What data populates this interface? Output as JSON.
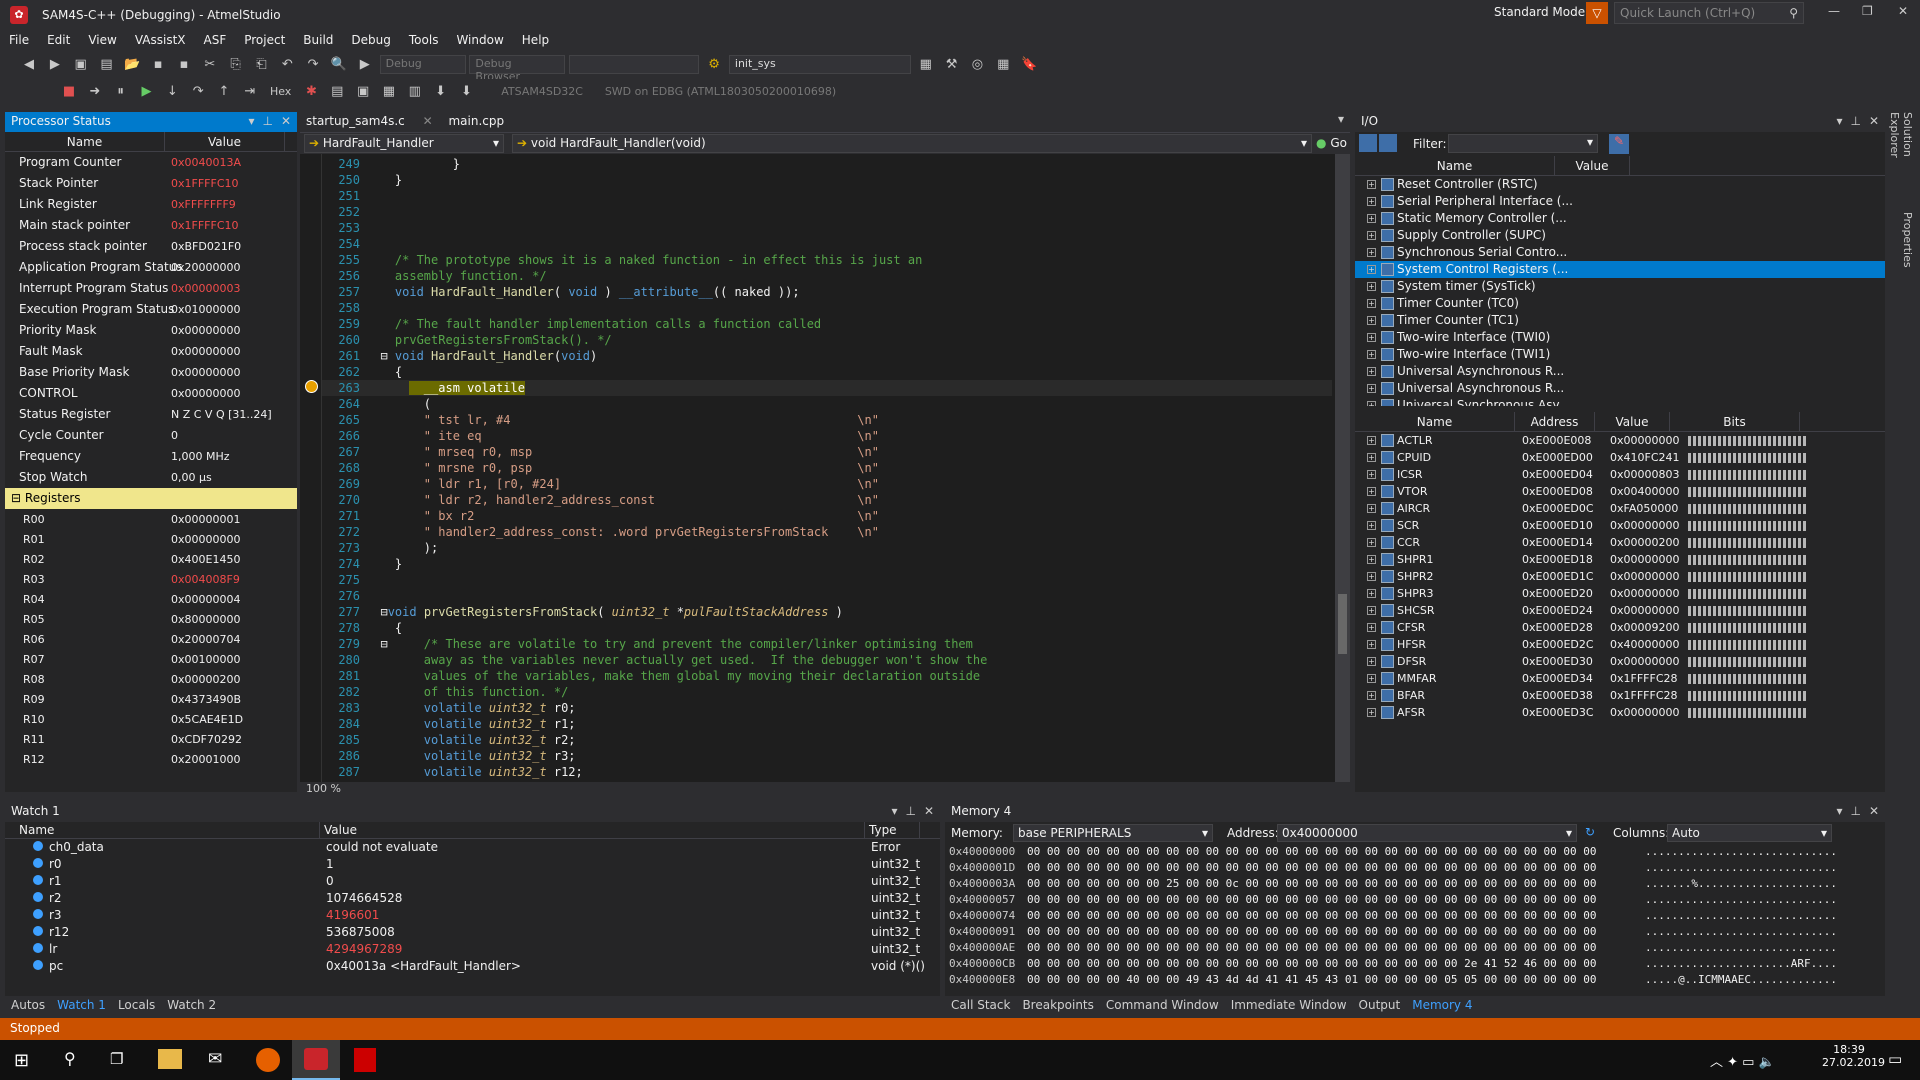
{
  "window": {
    "title": "SAM4S-C++ (Debugging) - AtmelStudio",
    "mode": "Standard Mode",
    "quick_launch": "Quick Launch (Ctrl+Q)"
  },
  "menu": [
    "File",
    "Edit",
    "View",
    "VAssistX",
    "ASF",
    "Project",
    "Build",
    "Debug",
    "Tools",
    "Window",
    "Help"
  ],
  "toolbar": {
    "config": "Debug",
    "platform": "Debug Browser",
    "func": "init_sys",
    "hex": "Hex",
    "device": "ATSAM4SD32C",
    "tool": "SWD on EDBG (ATML1803050200010698)"
  },
  "processor": {
    "title": "Processor Status",
    "col_name": "Name",
    "col_value": "Value",
    "rows": [
      {
        "n": "Program Counter",
        "v": "0x0040013A",
        "red": true
      },
      {
        "n": "Stack Pointer",
        "v": "0x1FFFFC10",
        "red": true
      },
      {
        "n": "Link Register",
        "v": "0xFFFFFFF9",
        "red": true
      },
      {
        "n": "Main stack pointer",
        "v": "0x1FFFFC10",
        "red": true
      },
      {
        "n": "Process stack pointer",
        "v": "0xBFD021F0",
        "red": false
      },
      {
        "n": "Application Program Status",
        "v": "0x20000000",
        "red": false
      },
      {
        "n": "Interrupt Program Status",
        "v": "0x00000003",
        "red": true
      },
      {
        "n": "Execution Program Status",
        "v": "0x01000000",
        "red": false
      },
      {
        "n": "Priority Mask",
        "v": "0x00000000",
        "red": false
      },
      {
        "n": "Fault Mask",
        "v": "0x00000000",
        "red": false
      },
      {
        "n": "Base Priority Mask",
        "v": "0x00000000",
        "red": false
      },
      {
        "n": "CONTROL",
        "v": "0x00000000",
        "red": false
      },
      {
        "n": "Status Register",
        "v": "N Z C V Q [31..24]",
        "red": false
      },
      {
        "n": "Cycle Counter",
        "v": "0",
        "red": false
      },
      {
        "n": "Frequency",
        "v": "1,000 MHz",
        "red": false
      },
      {
        "n": "Stop Watch",
        "v": "0,00 µs",
        "red": false
      }
    ],
    "registers_label": "Registers",
    "regs": [
      {
        "n": "R00",
        "v": "0x00000001",
        "red": false
      },
      {
        "n": "R01",
        "v": "0x00000000",
        "red": false
      },
      {
        "n": "R02",
        "v": "0x400E1450",
        "red": false
      },
      {
        "n": "R03",
        "v": "0x004008F9",
        "red": true
      },
      {
        "n": "R04",
        "v": "0x00000004",
        "red": false
      },
      {
        "n": "R05",
        "v": "0x80000000",
        "red": false
      },
      {
        "n": "R06",
        "v": "0x20000704",
        "red": false
      },
      {
        "n": "R07",
        "v": "0x00100000",
        "red": false
      },
      {
        "n": "R08",
        "v": "0x00000200",
        "red": false
      },
      {
        "n": "R09",
        "v": "0x4373490B",
        "red": false
      },
      {
        "n": "R10",
        "v": "0x5CAE4E1D",
        "red": false
      },
      {
        "n": "R11",
        "v": "0xCDF70292",
        "red": false
      },
      {
        "n": "R12",
        "v": "0x20001000",
        "red": false
      }
    ]
  },
  "editor": {
    "tabs": [
      "startup_sam4s.c",
      "main.cpp"
    ],
    "nav_left": "HardFault_Handler",
    "nav_right": "void HardFault_Handler(void)",
    "go": "Go",
    "zoom": "100 %",
    "lines": [
      {
        "n": "249",
        "html": "            }"
      },
      {
        "n": "250",
        "html": "    }"
      },
      {
        "n": "251",
        "html": ""
      },
      {
        "n": "252",
        "html": ""
      },
      {
        "n": "253",
        "html": ""
      },
      {
        "n": "254",
        "html": ""
      },
      {
        "n": "255",
        "html": "<span class='cm'>    /* The prototype shows it is a naked function - in effect this is just an</span>"
      },
      {
        "n": "256",
        "html": "<span class='cm'>    assembly function. */</span>"
      },
      {
        "n": "257",
        "html": "    <span class='kw'>void</span> <span class='fn'>HardFault_Handler</span>( <span class='kw'>void</span> ) <span class='kw'>__attribute__</span>(( naked ));"
      },
      {
        "n": "258",
        "html": ""
      },
      {
        "n": "259",
        "html": "<span class='cm'>    /* The fault handler implementation calls a function called</span>"
      },
      {
        "n": "260",
        "html": "<span class='cm'>    prvGetRegistersFromStack(). */</span>"
      },
      {
        "n": "261",
        "html": "  ⊟ <span class='kw'>void</span> <span class='fn'>HardFault_Handler</span>(<span class='kw'>void</span>)"
      },
      {
        "n": "262",
        "html": "    {"
      },
      {
        "n": "263",
        "html": "      <span style='background:#6b6b00;color:#fff'>  __asm volatile</span>"
      },
      {
        "n": "264",
        "html": "        ("
      },
      {
        "n": "265",
        "html": "<span class='st'>        \" tst lr, #4                                                \\n\"</span>"
      },
      {
        "n": "266",
        "html": "<span class='st'>        \" ite eq                                                    \\n\"</span>"
      },
      {
        "n": "267",
        "html": "<span class='st'>        \" mrseq r0, msp                                             \\n\"</span>"
      },
      {
        "n": "268",
        "html": "<span class='st'>        \" mrsne r0, psp                                             \\n\"</span>"
      },
      {
        "n": "269",
        "html": "<span class='st'>        \" ldr r1, [r0, #24]                                         \\n\"</span>"
      },
      {
        "n": "270",
        "html": "<span class='st'>        \" ldr r2, handler2_address_const                            \\n\"</span>"
      },
      {
        "n": "271",
        "html": "<span class='st'>        \" bx r2                                                     \\n\"</span>"
      },
      {
        "n": "272",
        "html": "<span class='st'>        \" handler2_address_const: .word prvGetRegistersFromStack    \\n\"</span>"
      },
      {
        "n": "273",
        "html": "        );"
      },
      {
        "n": "274",
        "html": "    }"
      },
      {
        "n": "275",
        "html": ""
      },
      {
        "n": "276",
        "html": ""
      },
      {
        "n": "277",
        "html": "  ⊟<span class='kw'>void</span> <span class='fn'>prvGetRegistersFromStack</span>( <span class='it'>uint32_t</span> *<span class='it'>pulFaultStackAddress</span> )"
      },
      {
        "n": "278",
        "html": "    {"
      },
      {
        "n": "279",
        "html": "  ⊟     <span class='cm'>/* These are volatile to try and prevent the compiler/linker optimising them</span>"
      },
      {
        "n": "280",
        "html": "<span class='cm'>        away as the variables never actually get used.  If the debugger won't show the</span>"
      },
      {
        "n": "281",
        "html": "<span class='cm'>        values of the variables, make them global my moving their declaration outside</span>"
      },
      {
        "n": "282",
        "html": "<span class='cm'>        of this function. */</span>"
      },
      {
        "n": "283",
        "html": "        <span class='kw'>volatile</span> <span class='it'>uint32_t</span> r0;"
      },
      {
        "n": "284",
        "html": "        <span class='kw'>volatile</span> <span class='it'>uint32_t</span> r1;"
      },
      {
        "n": "285",
        "html": "        <span class='kw'>volatile</span> <span class='it'>uint32_t</span> r2;"
      },
      {
        "n": "286",
        "html": "        <span class='kw'>volatile</span> <span class='it'>uint32_t</span> r3;"
      },
      {
        "n": "287",
        "html": "        <span class='kw'>volatile</span> <span class='it'>uint32_t</span> r12;"
      }
    ]
  },
  "io": {
    "title": "I/O",
    "filter": "Filter:",
    "col_name": "Name",
    "col_value": "Value",
    "periph": [
      "Reset Controller (RSTC)",
      "Serial Peripheral Interface (...",
      "Static Memory Controller (...",
      "Supply Controller (SUPC)",
      "Synchronous Serial Contro...",
      "System Control Registers (...",
      "System timer (SysTick)",
      "Timer Counter (TC0)",
      "Timer Counter (TC1)",
      "Two-wire Interface (TWI0)",
      "Two-wire Interface (TWI1)",
      "Universal Asynchronous R...",
      "Universal Asynchronous R...",
      "Universal Synchronous Asy..."
    ],
    "selected": 5,
    "reg_cols": [
      "Name",
      "Address",
      "Value",
      "Bits"
    ],
    "regs": [
      [
        "ACTLR",
        "0xE000E008",
        "0x00000000"
      ],
      [
        "CPUID",
        "0xE000ED00",
        "0x410FC241"
      ],
      [
        "ICSR",
        "0xE000ED04",
        "0x00000803"
      ],
      [
        "VTOR",
        "0xE000ED08",
        "0x00400000"
      ],
      [
        "AIRCR",
        "0xE000ED0C",
        "0xFA050000"
      ],
      [
        "SCR",
        "0xE000ED10",
        "0x00000000"
      ],
      [
        "CCR",
        "0xE000ED14",
        "0x00000200"
      ],
      [
        "SHPR1",
        "0xE000ED18",
        "0x00000000"
      ],
      [
        "SHPR2",
        "0xE000ED1C",
        "0x00000000"
      ],
      [
        "SHPR3",
        "0xE000ED20",
        "0x00000000"
      ],
      [
        "SHCSR",
        "0xE000ED24",
        "0x00000000"
      ],
      [
        "CFSR",
        "0xE000ED28",
        "0x00009200"
      ],
      [
        "HFSR",
        "0xE000ED2C",
        "0x40000000"
      ],
      [
        "DFSR",
        "0xE000ED30",
        "0x00000000"
      ],
      [
        "MMFAR",
        "0xE000ED34",
        "0x1FFFFC28"
      ],
      [
        "BFAR",
        "0xE000ED38",
        "0x1FFFFC28"
      ],
      [
        "AFSR",
        "0xE000ED3C",
        "0x00000000"
      ]
    ]
  },
  "watch": {
    "title": "Watch 1",
    "cols": [
      "Name",
      "Value",
      "Type"
    ],
    "rows": [
      {
        "n": "ch0_data",
        "v": "could not evaluate",
        "t": "Error",
        "red": false
      },
      {
        "n": "r0",
        "v": "1",
        "t": "uint32_t",
        "red": false
      },
      {
        "n": "r1",
        "v": "0",
        "t": "uint32_t",
        "red": false
      },
      {
        "n": "r2",
        "v": "1074664528",
        "t": "uint32_t",
        "red": false
      },
      {
        "n": "r3",
        "v": "4196601",
        "t": "uint32_t",
        "red": true
      },
      {
        "n": "r12",
        "v": "536875008",
        "t": "uint32_t",
        "red": false
      },
      {
        "n": "lr",
        "v": "4294967289",
        "t": "uint32_t",
        "red": true
      },
      {
        "n": "pc",
        "v": "0x40013a <HardFault_Handler>",
        "t": "void (*)()",
        "red": false
      }
    ],
    "tabs": [
      "Autos",
      "Watch 1",
      "Locals",
      "Watch 2"
    ]
  },
  "memory": {
    "title": "Memory 4",
    "mem_label": "Memory:",
    "mem_value": "base PERIPHERALS",
    "addr_label": "Address:",
    "addr_value": "0x40000000",
    "cols_label": "Columns:",
    "cols_value": "Auto",
    "rows": [
      [
        "0x40000000",
        "00 00 00 00 00 00 00 00 00 00 00 00 00 00 00 00 00 00 00 00 00 00 00 00 00 00 00 00 00",
        "............................."
      ],
      [
        "0x4000001D",
        "00 00 00 00 00 00 00 00 00 00 00 00 00 00 00 00 00 00 00 00 00 00 00 00 00 00 00 00 00",
        "............................."
      ],
      [
        "0x4000003A",
        "00 00 00 00 00 00 00 25 00 00 0c 00 00 00 00 00 00 00 00 00 00 00 00 00 00 00 00 00 00",
        ".......%....................."
      ],
      [
        "0x40000057",
        "00 00 00 00 00 00 00 00 00 00 00 00 00 00 00 00 00 00 00 00 00 00 00 00 00 00 00 00 00",
        "............................."
      ],
      [
        "0x40000074",
        "00 00 00 00 00 00 00 00 00 00 00 00 00 00 00 00 00 00 00 00 00 00 00 00 00 00 00 00 00",
        "............................."
      ],
      [
        "0x40000091",
        "00 00 00 00 00 00 00 00 00 00 00 00 00 00 00 00 00 00 00 00 00 00 00 00 00 00 00 00 00",
        "............................."
      ],
      [
        "0x400000AE",
        "00 00 00 00 00 00 00 00 00 00 00 00 00 00 00 00 00 00 00 00 00 00 00 00 00 00 00 00 00",
        "............................."
      ],
      [
        "0x400000CB",
        "00 00 00 00 00 00 00 00 00 00 00 00 00 00 00 00 00 00 00 00 00 00 2e 41 52 46 00 00 00",
        "......................ARF...."
      ],
      [
        "0x400000E8",
        "00 00 00 00 00 40 00 00 49 43 4d 4d 41 41 45 43 01 00 00 00 00 05 05 00 00 00 00 00 00",
        ".....@..ICMMAAEC............."
      ]
    ],
    "tabs": [
      "Call Stack",
      "Breakpoints",
      "Command Window",
      "Immediate Window",
      "Output",
      "Memory 4"
    ]
  },
  "status": "Stopped",
  "clock": {
    "time": "18:39",
    "date": "27.02.2019"
  },
  "colors": {
    "accent": "#007acc",
    "status": "#ca5100",
    "red": "#f14c4c"
  }
}
